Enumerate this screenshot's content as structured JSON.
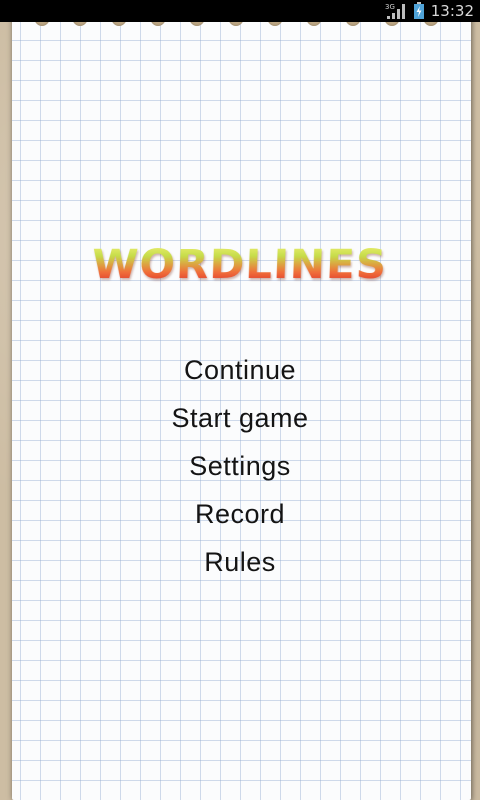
{
  "status_bar": {
    "network_label": "3G",
    "time": "13:32",
    "icons": [
      "signal-icon",
      "battery-icon"
    ]
  },
  "title": "WORDLINES",
  "menu": {
    "items": [
      {
        "label": "Continue"
      },
      {
        "label": "Start game"
      },
      {
        "label": "Settings"
      },
      {
        "label": "Record"
      },
      {
        "label": "Rules"
      }
    ]
  },
  "colors": {
    "grid_line": "#96afd2",
    "paper": "#fbfcfd",
    "background": "#cdbda3",
    "title_top": "#f6f279",
    "title_bottom": "#d81e24",
    "menu_text": "#141414"
  }
}
